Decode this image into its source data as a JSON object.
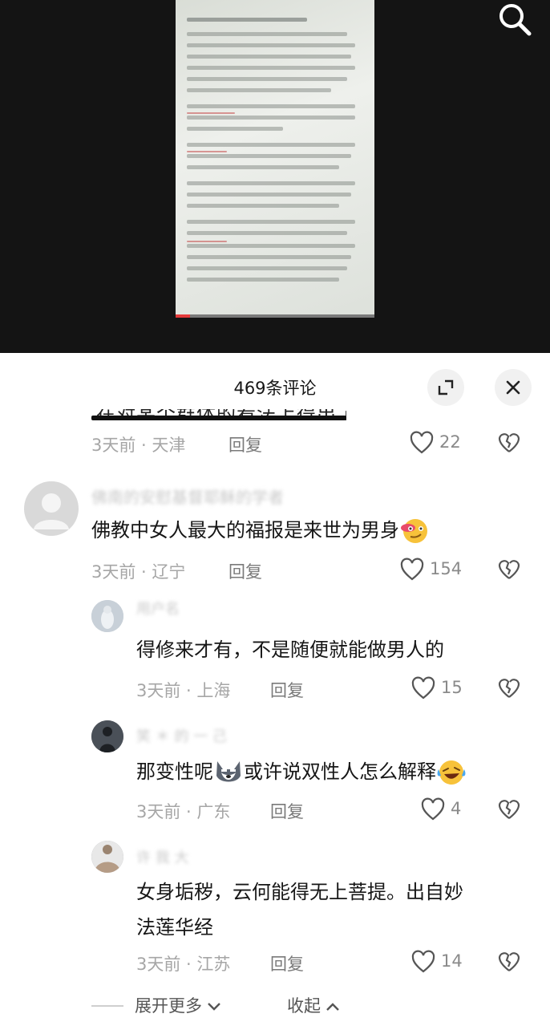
{
  "sheet": {
    "title": "469条评论"
  },
  "top_comment": {
    "cut_text": "在对某个群体的看法上得出了一致的",
    "time": "3天前",
    "location": "天津",
    "reply_label": "回复",
    "likes": "22"
  },
  "comments": [
    {
      "username": "佛南的安慰基督耶稣的学者",
      "text": "佛教中女人最大的福报是来世为男身",
      "emoji": "smirk-emoji",
      "time": "3天前",
      "location": "辽宁",
      "reply_label": "回复",
      "likes": "154"
    },
    {
      "username": "用户名",
      "text": "得修来才有，不是随便就能做男人的",
      "time": "3天前",
      "location": "上海",
      "reply_label": "回复",
      "likes": "15"
    },
    {
      "username": "笑 ＊ 的 一 己",
      "text_part1": "那变性呢",
      "text_part2": "或许说双性人怎么解释",
      "emoji1": "husky-dog-emoji",
      "emoji2": "laughing-tears-emoji",
      "time": "3天前",
      "location": "广东",
      "reply_label": "回复",
      "likes": "4"
    },
    {
      "username": "许 我 大",
      "text_line1": "女身垢秽，云何能得无上菩提。出自妙",
      "text_line2": "法莲华经",
      "time": "3天前",
      "location": "江苏",
      "reply_label": "回复",
      "likes": "14"
    }
  ],
  "footer": {
    "expand_label": "展开更多",
    "collapse_label": "收起"
  },
  "colors": {
    "dark_bg": "#141414",
    "meta_gray": "#a6a6a6",
    "text": "#161616"
  }
}
